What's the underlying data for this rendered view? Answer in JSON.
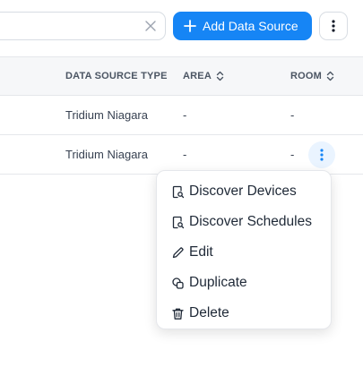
{
  "toolbar": {
    "search": {
      "value": "",
      "placeholder": ""
    },
    "add_button_label": "Add Data Source",
    "colors": {
      "primary": "#1685f5"
    }
  },
  "table": {
    "columns": [
      {
        "label": "DATA SOURCE TYPE",
        "sortable": false
      },
      {
        "label": "AREA",
        "sortable": true
      },
      {
        "label": "ROOM",
        "sortable": true
      }
    ],
    "rows": [
      {
        "type": "Tridium Niagara",
        "area": "-",
        "room": "-"
      },
      {
        "type": "Tridium Niagara",
        "area": "-",
        "room": "-"
      }
    ]
  },
  "row_menu": {
    "items": [
      {
        "label": "Discover Devices",
        "icon": "discover-icon"
      },
      {
        "label": "Discover Schedules",
        "icon": "discover-icon"
      },
      {
        "label": "Edit",
        "icon": "pencil-icon"
      },
      {
        "label": "Duplicate",
        "icon": "duplicate-icon"
      },
      {
        "label": "Delete",
        "icon": "trash-icon"
      }
    ]
  }
}
